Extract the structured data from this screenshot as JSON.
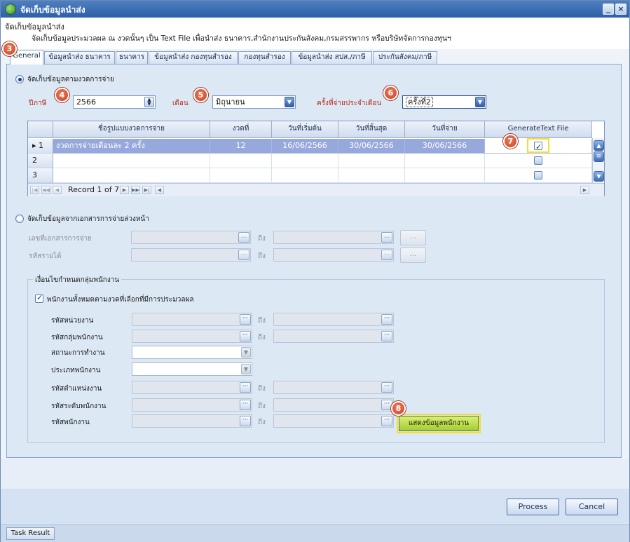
{
  "window": {
    "title": "จัดเก็บข้อมูลนำส่ง",
    "header_title": "จัดเก็บข้อมูลนำส่ง",
    "header_desc": "จัดเก็บข้อมูลประมวลผล ณ งวดนั้นๆ เป็น Text File เพื่อนำส่ง ธนาคาร,สำนักงานประกันสังคม,กรมสรรพากร หรือบริษัทจัดการกองทุนฯ"
  },
  "tabs": [
    "General",
    "ข้อมูลนำส่ง ธนาคาร",
    "ธนาคาร",
    "ข้อมูลนำส่ง กองทุนสำรอง",
    "กองทุนสำรอง",
    "ข้อมูลนำส่ง สปส./ภาษี",
    "ประกันสังคม/ภาษี"
  ],
  "badges": {
    "b3": "3",
    "b4": "4",
    "b5": "5",
    "b6": "6",
    "b7": "7",
    "b8": "8"
  },
  "section1": {
    "radio_label": "จัดเก็บข้อมูลตามงวดการจ่าย",
    "year_label": "ปีภาษี",
    "year_value": "2566",
    "month_label": "เดือน",
    "month_value": "มิถุนายน",
    "period_label": "ครั้งที่จ่ายประจำเดือน",
    "period_value": "ครั้งที่2"
  },
  "grid": {
    "headers": [
      "ชื่อรูปแบบงวดการจ่าย",
      "งวดที่",
      "วันที่เริ่มต้น",
      "วันที่สิ้นสุด",
      "วันที่จ่าย",
      "GenerateText File"
    ],
    "rows": [
      {
        "num": "1",
        "name": "งวดการจ่ายเดือนละ 2 ครั้ง",
        "period": "12",
        "start": "16/06/2566",
        "end": "30/06/2566",
        "pay": "30/06/2566",
        "generate": true
      },
      {
        "num": "2",
        "name": "",
        "period": "",
        "start": "",
        "end": "",
        "pay": "",
        "generate": false
      },
      {
        "num": "3",
        "name": "",
        "period": "",
        "start": "",
        "end": "",
        "pay": "",
        "generate": false
      }
    ],
    "record_text": "Record 1 of 7"
  },
  "section2": {
    "radio_label": "จัดเก็บข้อมูลจากเอกสารการจ่ายล่วงหน้า",
    "doc_label": "เลขที่เอกสารการจ่าย",
    "income_label": "รหัสรายได้",
    "to": "ถึง",
    "ellipsis": "..."
  },
  "conditions": {
    "title": "เงื่อนไขกำหนดกลุ่มพนักงาน",
    "all_label": "พนักงานทั้งหมดตามงวดที่เลือกที่มีการประมวลผล",
    "unit": "รหัสหน่วยงาน",
    "group": "รหัสกลุ่มพนักงาน",
    "status": "สถานะการทำงาน",
    "type": "ประเภทพนักงาน",
    "position": "รหัสตำแหน่งงาน",
    "level": "รหัสระดับพนักงาน",
    "employee": "รหัสพนักงาน",
    "to": "ถึง",
    "show_button": "แสดงข้อมูลพนักงาน"
  },
  "footer": {
    "process": "Process",
    "cancel": "Cancel",
    "task_result": "Task Result"
  },
  "colors": {
    "highlight": "#f3df2c",
    "badge": "#d9512f",
    "selected_row": "#97a8dc",
    "accent": "#2c5fa8"
  }
}
